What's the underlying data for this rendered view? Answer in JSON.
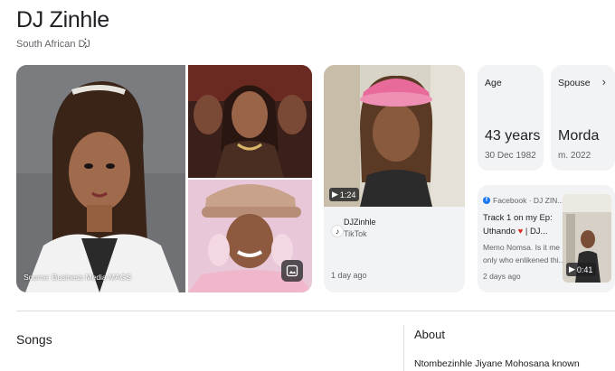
{
  "header": {
    "title": "DJ Zinhle",
    "subtitle": "South African DJ"
  },
  "gallery": {
    "source_caption": "Source: Business Media MAGS"
  },
  "tiktok": {
    "duration": "1:24",
    "name": "DJZinhle",
    "platform": "TikTok",
    "time": "1 day ago"
  },
  "facts": {
    "age": {
      "label": "Age",
      "value": "43 years",
      "sub": "30 Dec 1982"
    },
    "spouse": {
      "label": "Spouse",
      "value": "Morda",
      "sub": "m. 2022"
    }
  },
  "facebook": {
    "source": "Facebook · DJ ZIN...",
    "line1": "Track 1 on my Ep:",
    "line2a": "Uthando",
    "line2b": "| DJ...",
    "line3": "Memo Nomsa. Is it me",
    "line4": "only who enlikened thi...",
    "time": "2 days ago",
    "duration": "0:41"
  },
  "sections": {
    "songs": "Songs",
    "about": "About",
    "about_text": "Ntombezinhle Jiyane Mohosana known"
  },
  "colors": {
    "accent_heart": "#d93025",
    "facebook_blue": "#1877f2"
  }
}
